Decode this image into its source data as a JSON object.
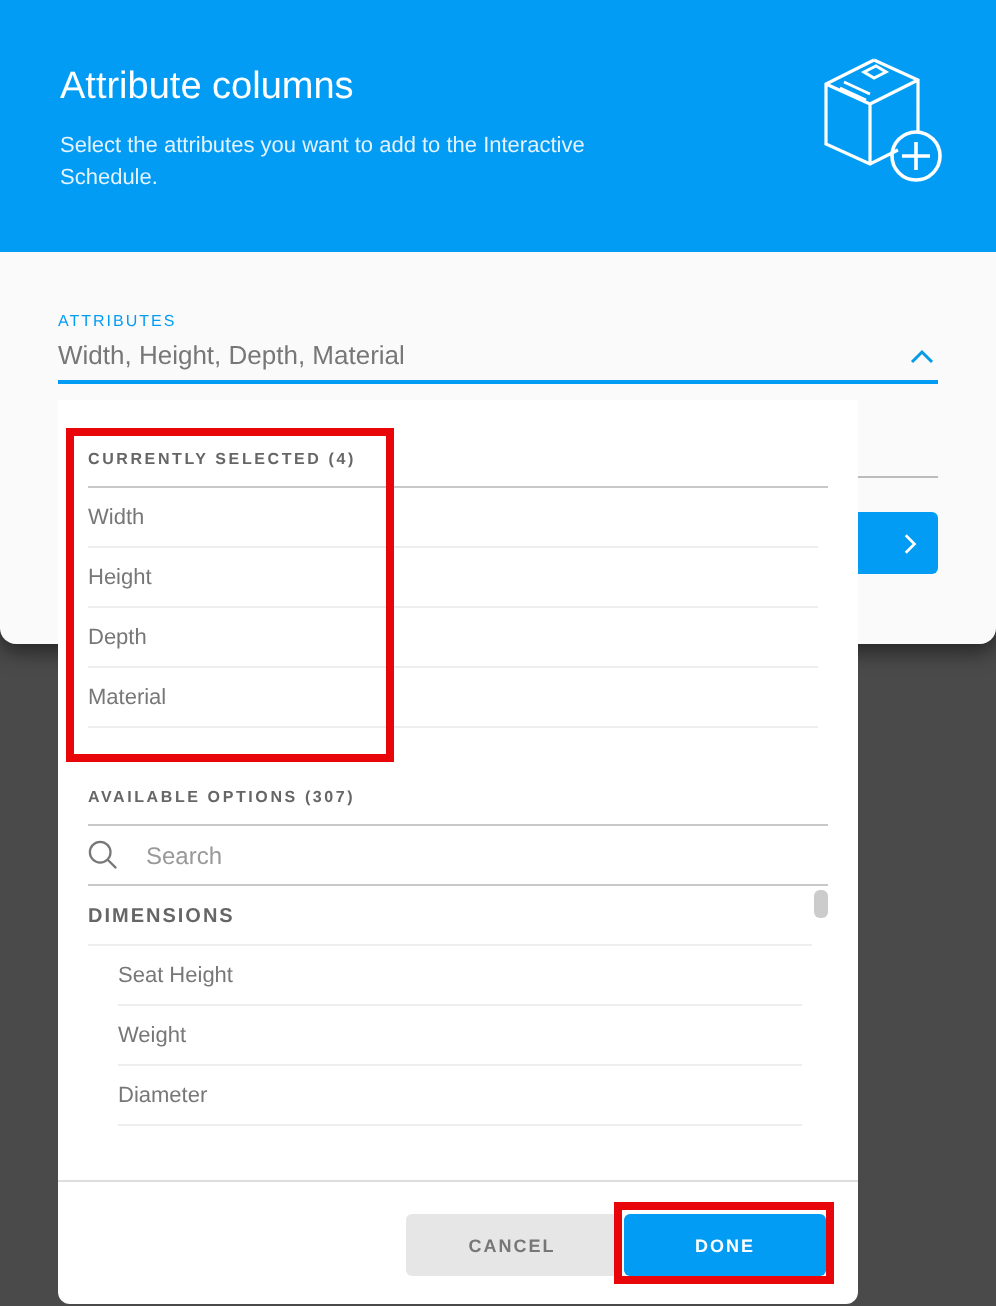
{
  "dialog": {
    "title": "Attribute columns",
    "subtitle": "Select the attributes you want to add to the Interactive Schedule."
  },
  "field": {
    "label": "ATTRIBUTES",
    "value": "Width, Height, Depth, Material",
    "expanded": true
  },
  "dropdown": {
    "selected_section": {
      "title": "CURRENTLY SELECTED (4)",
      "highlighted": true,
      "items": [
        "Width",
        "Height",
        "Depth",
        "Material"
      ]
    },
    "available_section": {
      "title": "AVAILABLE OPTIONS (307)",
      "search": {
        "placeholder": "Search"
      },
      "groups": [
        {
          "title": "DIMENSIONS",
          "items": [
            "Seat Height",
            "Weight",
            "Diameter"
          ]
        }
      ]
    },
    "buttons": [
      {
        "label": "CANCEL",
        "kind": "secondary",
        "highlighted": false
      },
      {
        "label": "DONE",
        "kind": "primary",
        "highlighted": true
      }
    ]
  }
}
